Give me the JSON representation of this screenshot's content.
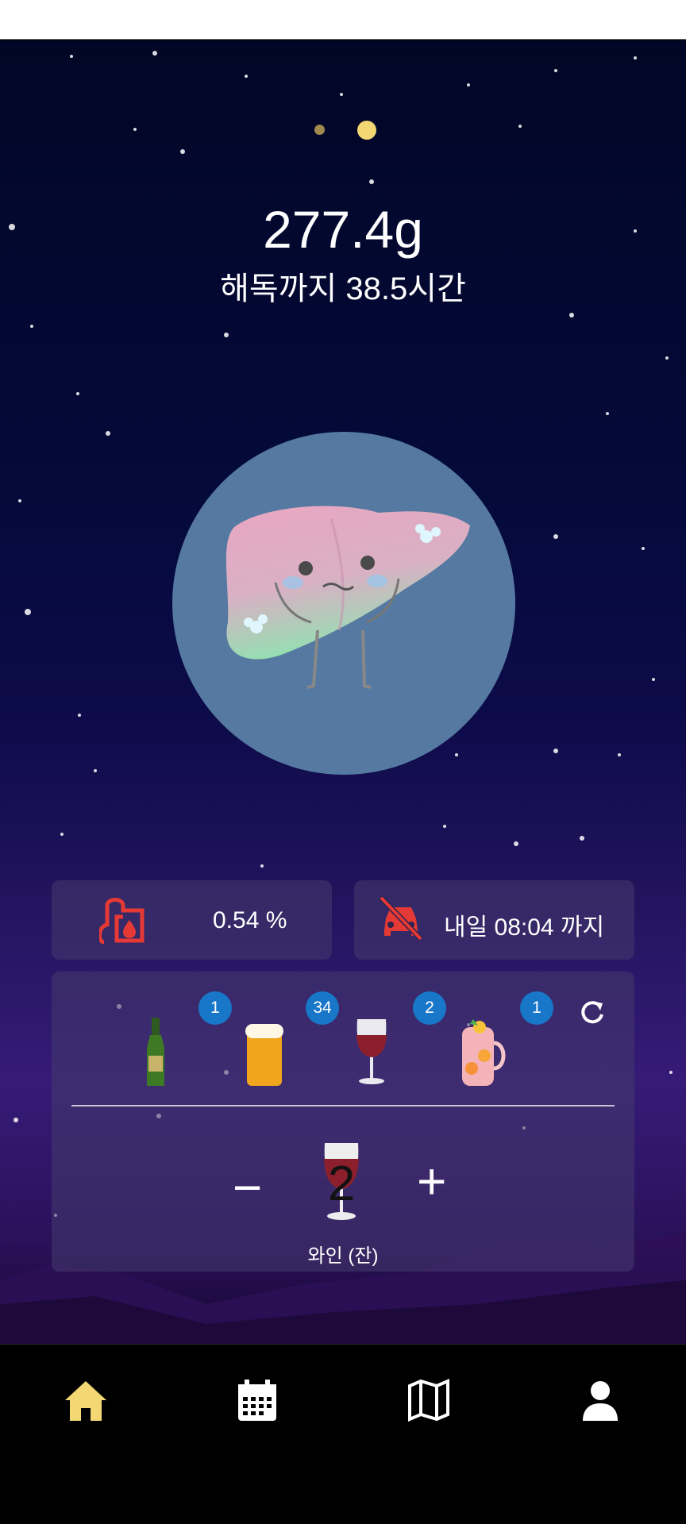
{
  "status": {
    "amount": "277.4g",
    "detox_label": "해독까지  38.5시간"
  },
  "pager": {
    "pages": 2,
    "active": 2
  },
  "cards": {
    "bac": {
      "icon": "blood-alcohol-icon",
      "value": "0.54 %"
    },
    "drive": {
      "icon": "no-driving-icon",
      "value": "내일 08:04 까지"
    }
  },
  "drinks": [
    {
      "name": "beer-bottle",
      "icon": "beer-bottle-icon",
      "count": "1"
    },
    {
      "name": "beer-mug",
      "icon": "beer-mug-icon",
      "count": "34"
    },
    {
      "name": "wine-glass",
      "icon": "wine-glass-icon",
      "count": "2"
    },
    {
      "name": "cocktail",
      "icon": "cocktail-icon",
      "count": "1"
    }
  ],
  "selector": {
    "minus": "−",
    "plus": "+",
    "count": "2",
    "label": "와인 (잔)"
  },
  "nav": [
    "home-icon",
    "calendar-icon",
    "map-icon",
    "profile-icon"
  ],
  "colors": {
    "accent": "#f2d773",
    "badge": "#1877c8",
    "alert_red": "#e53935",
    "liver_circle": "#5579a0"
  }
}
